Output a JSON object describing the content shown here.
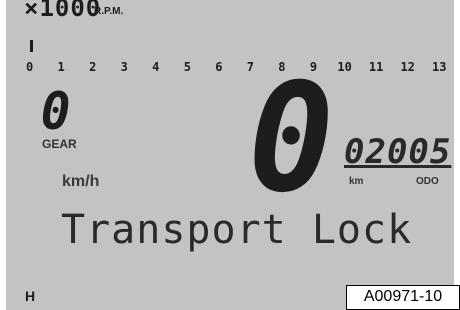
{
  "rpm": {
    "multiplier": "×1000",
    "unit": "R.P.M.",
    "scale_labels": [
      "0",
      "1",
      "2",
      "3",
      "4",
      "5",
      "6",
      "7",
      "8",
      "9",
      "10",
      "11",
      "12",
      "13"
    ]
  },
  "gear": {
    "value": "0",
    "label": "GEAR"
  },
  "speed": {
    "value": "0",
    "unit": "km/h"
  },
  "odometer": {
    "value": "02005",
    "unit_km": "km",
    "unit_odo": "ODO"
  },
  "status_message": "Transport Lock",
  "partial_bottom_left": "H",
  "reference_code": "A00971-10"
}
